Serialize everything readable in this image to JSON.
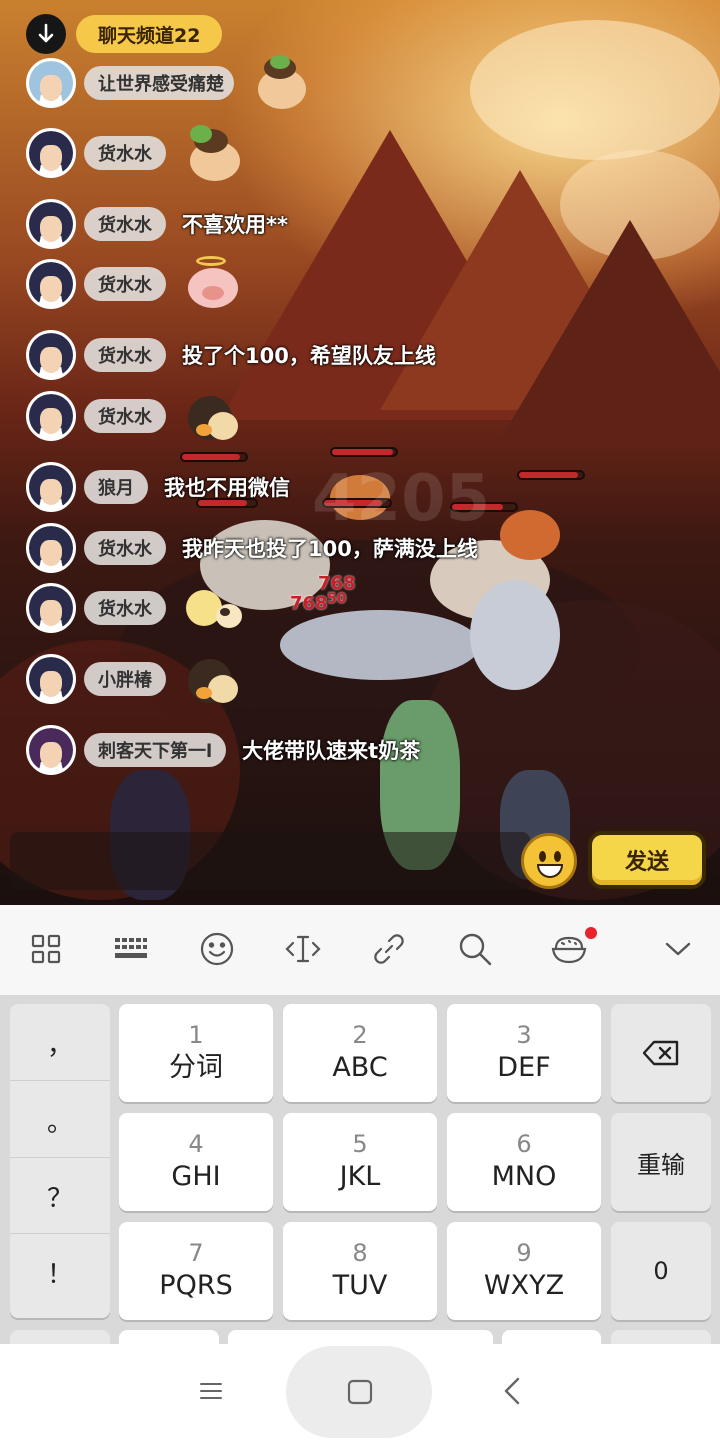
{
  "chat": {
    "channel_label": "聊天频道22",
    "messages": [
      {
        "name": "让世界感受痛楚",
        "type": "sticker",
        "sticker": "toad-sticker",
        "text": ""
      },
      {
        "name": "货水水",
        "type": "sticker",
        "sticker": "toad-sticker",
        "text": ""
      },
      {
        "name": "货水水",
        "type": "text",
        "sticker": "",
        "text": "不喜欢用**"
      },
      {
        "name": "货水水",
        "type": "sticker",
        "sticker": "angel-pig-sticker",
        "text": ""
      },
      {
        "name": "货水水",
        "type": "text",
        "sticker": "",
        "text": "投了个100，希望队友上线"
      },
      {
        "name": "货水水",
        "type": "sticker",
        "sticker": "dino-sticker",
        "text": ""
      },
      {
        "name": "狼月",
        "type": "text",
        "sticker": "",
        "text": "我也不用微信"
      },
      {
        "name": "货水水",
        "type": "text",
        "sticker": "",
        "text": "我昨天也投了100，萨满没上线"
      },
      {
        "name": "货水水",
        "type": "sticker",
        "sticker": "chick-sticker",
        "text": ""
      },
      {
        "name": "小胖椿",
        "type": "sticker",
        "sticker": "dino-sticker",
        "text": ""
      },
      {
        "name": "刺客天下第一l",
        "type": "text",
        "sticker": "",
        "text": "大佬带队速来t奶茶"
      }
    ],
    "input_placeholder": "",
    "send_label": "发送"
  },
  "game": {
    "damage_numbers": [
      "768",
      "768",
      "50"
    ],
    "watermark": "4205"
  },
  "keyboard": {
    "toolbar_icons": [
      "grid-icon",
      "keyboard-icon",
      "emoji-icon",
      "cursor-icon",
      "link-icon",
      "search-icon",
      "rice-bowl-icon",
      "chevron-down-icon"
    ],
    "punctuation": [
      "，",
      "。",
      "？",
      "！"
    ],
    "keys": [
      {
        "num": "1",
        "letters": "分词"
      },
      {
        "num": "2",
        "letters": "ABC"
      },
      {
        "num": "3",
        "letters": "DEF"
      },
      {
        "num": "4",
        "letters": "GHI"
      },
      {
        "num": "5",
        "letters": "JKL"
      },
      {
        "num": "6",
        "letters": "MNO"
      },
      {
        "num": "7",
        "letters": "PQRS"
      },
      {
        "num": "8",
        "letters": "TUV"
      },
      {
        "num": "9",
        "letters": "WXYZ"
      }
    ],
    "reenter_label": "重输",
    "zero_label": "0"
  },
  "colors": {
    "accent_yellow": "#f5c84a",
    "notification_dot": "#e8232b"
  }
}
